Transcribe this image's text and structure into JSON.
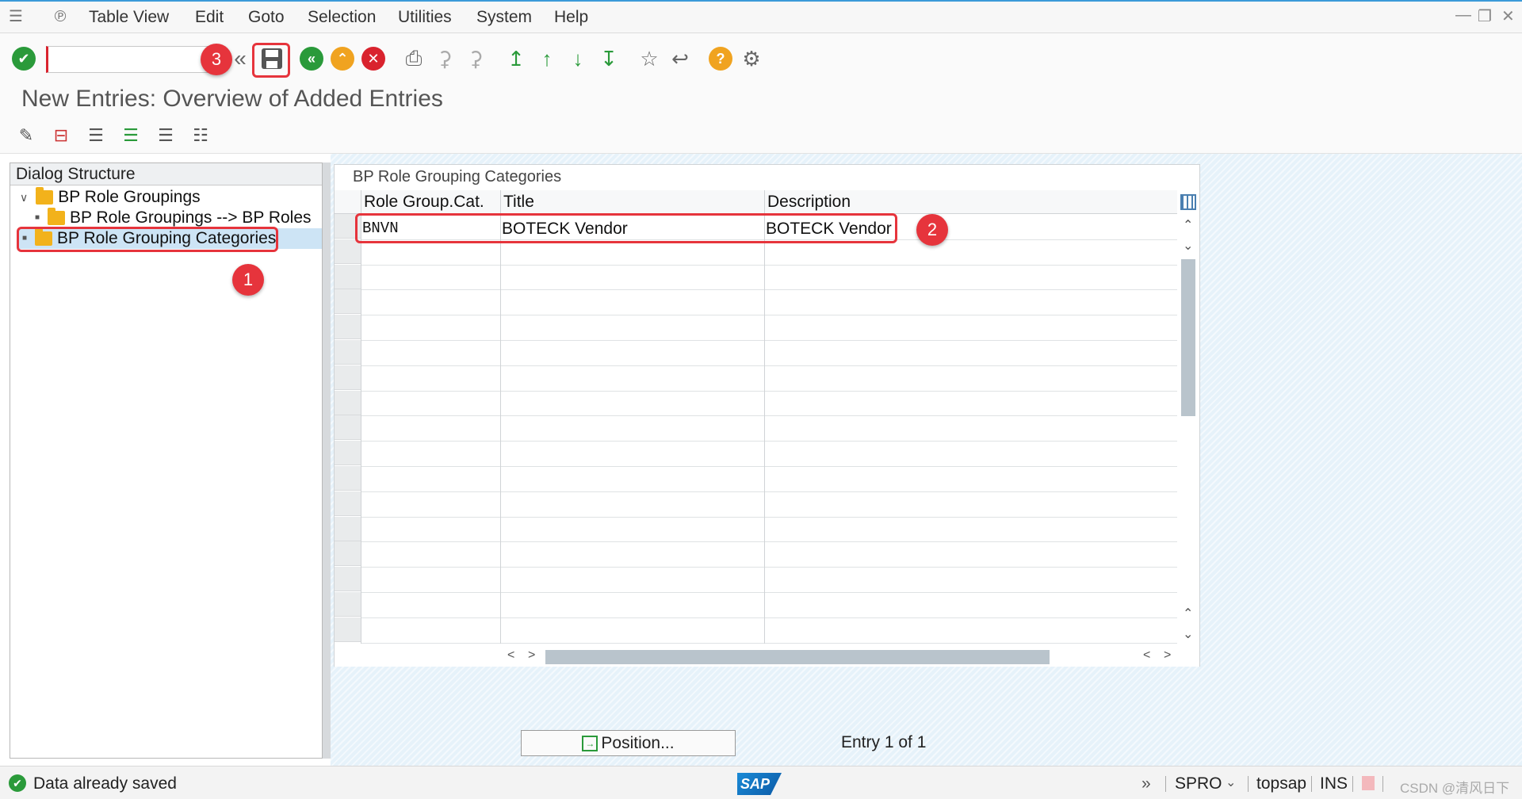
{
  "menubar": {
    "items": [
      "Table View",
      "Edit",
      "Goto",
      "Selection",
      "Utilities",
      "System",
      "Help"
    ],
    "window_controls": [
      "minimize-icon",
      "restore-icon",
      "close-icon"
    ]
  },
  "toolbar": {
    "command_field_value": "",
    "buttons": [
      "enter-icon",
      "save-icon",
      "back-icon",
      "exit-icon",
      "cancel-icon",
      "print-icon",
      "find-icon",
      "find-next-icon",
      "first-page-icon",
      "previous-page-icon",
      "next-page-icon",
      "last-page-icon",
      "create-session-icon",
      "generate-shortcut-icon",
      "help-icon",
      "settings-icon"
    ]
  },
  "annotations": {
    "badge_1": "1",
    "badge_2": "2",
    "badge_3": "3",
    "highlight_color": "#e6343c"
  },
  "page": {
    "title": "New Entries: Overview of Added Entries"
  },
  "dialog_structure": {
    "header": "Dialog Structure",
    "nodes": [
      {
        "label": "BP Role Groupings"
      },
      {
        "label": "BP Role Groupings --> BP Roles"
      },
      {
        "label": "BP Role Grouping Categories"
      }
    ]
  },
  "table": {
    "caption": "BP Role Grouping Categories",
    "columns": [
      "Role Group.Cat.",
      "Title",
      "Description"
    ],
    "rows": [
      {
        "role_group_cat": "BNVN",
        "title": "BOTECK Vendor",
        "description": "BOTECK Vendor"
      }
    ]
  },
  "bottom": {
    "position_button": "Position...",
    "entry_text": "Entry 1 of 1"
  },
  "statusbar": {
    "message": "Data already saved",
    "logo_text": "SAP",
    "transaction": "SPRO",
    "system": "topsap",
    "mode": "INS",
    "watermark": "CSDN @清风日下"
  },
  "colors": {
    "accent": "#3b9ad9",
    "ok_green": "#2a9a3a",
    "cancel_red": "#d9232e",
    "exit_orange": "#f0a320",
    "selected_row": "#cde4f5",
    "panel_bg": "#e6f2fa"
  }
}
